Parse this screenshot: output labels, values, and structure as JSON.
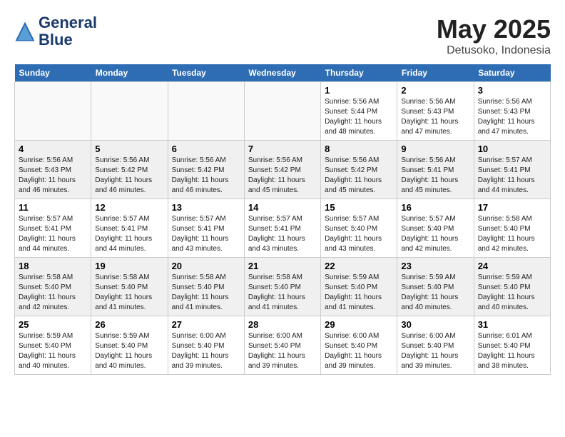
{
  "header": {
    "logo_line1": "General",
    "logo_line2": "Blue",
    "month": "May 2025",
    "location": "Detusoko, Indonesia"
  },
  "weekdays": [
    "Sunday",
    "Monday",
    "Tuesday",
    "Wednesday",
    "Thursday",
    "Friday",
    "Saturday"
  ],
  "weeks": [
    [
      {
        "day": "",
        "info": ""
      },
      {
        "day": "",
        "info": ""
      },
      {
        "day": "",
        "info": ""
      },
      {
        "day": "",
        "info": ""
      },
      {
        "day": "1",
        "info": "Sunrise: 5:56 AM\nSunset: 5:44 PM\nDaylight: 11 hours\nand 48 minutes."
      },
      {
        "day": "2",
        "info": "Sunrise: 5:56 AM\nSunset: 5:43 PM\nDaylight: 11 hours\nand 47 minutes."
      },
      {
        "day": "3",
        "info": "Sunrise: 5:56 AM\nSunset: 5:43 PM\nDaylight: 11 hours\nand 47 minutes."
      }
    ],
    [
      {
        "day": "4",
        "info": "Sunrise: 5:56 AM\nSunset: 5:43 PM\nDaylight: 11 hours\nand 46 minutes."
      },
      {
        "day": "5",
        "info": "Sunrise: 5:56 AM\nSunset: 5:42 PM\nDaylight: 11 hours\nand 46 minutes."
      },
      {
        "day": "6",
        "info": "Sunrise: 5:56 AM\nSunset: 5:42 PM\nDaylight: 11 hours\nand 46 minutes."
      },
      {
        "day": "7",
        "info": "Sunrise: 5:56 AM\nSunset: 5:42 PM\nDaylight: 11 hours\nand 45 minutes."
      },
      {
        "day": "8",
        "info": "Sunrise: 5:56 AM\nSunset: 5:42 PM\nDaylight: 11 hours\nand 45 minutes."
      },
      {
        "day": "9",
        "info": "Sunrise: 5:56 AM\nSunset: 5:41 PM\nDaylight: 11 hours\nand 45 minutes."
      },
      {
        "day": "10",
        "info": "Sunrise: 5:57 AM\nSunset: 5:41 PM\nDaylight: 11 hours\nand 44 minutes."
      }
    ],
    [
      {
        "day": "11",
        "info": "Sunrise: 5:57 AM\nSunset: 5:41 PM\nDaylight: 11 hours\nand 44 minutes."
      },
      {
        "day": "12",
        "info": "Sunrise: 5:57 AM\nSunset: 5:41 PM\nDaylight: 11 hours\nand 44 minutes."
      },
      {
        "day": "13",
        "info": "Sunrise: 5:57 AM\nSunset: 5:41 PM\nDaylight: 11 hours\nand 43 minutes."
      },
      {
        "day": "14",
        "info": "Sunrise: 5:57 AM\nSunset: 5:41 PM\nDaylight: 11 hours\nand 43 minutes."
      },
      {
        "day": "15",
        "info": "Sunrise: 5:57 AM\nSunset: 5:40 PM\nDaylight: 11 hours\nand 43 minutes."
      },
      {
        "day": "16",
        "info": "Sunrise: 5:57 AM\nSunset: 5:40 PM\nDaylight: 11 hours\nand 42 minutes."
      },
      {
        "day": "17",
        "info": "Sunrise: 5:58 AM\nSunset: 5:40 PM\nDaylight: 11 hours\nand 42 minutes."
      }
    ],
    [
      {
        "day": "18",
        "info": "Sunrise: 5:58 AM\nSunset: 5:40 PM\nDaylight: 11 hours\nand 42 minutes."
      },
      {
        "day": "19",
        "info": "Sunrise: 5:58 AM\nSunset: 5:40 PM\nDaylight: 11 hours\nand 41 minutes."
      },
      {
        "day": "20",
        "info": "Sunrise: 5:58 AM\nSunset: 5:40 PM\nDaylight: 11 hours\nand 41 minutes."
      },
      {
        "day": "21",
        "info": "Sunrise: 5:58 AM\nSunset: 5:40 PM\nDaylight: 11 hours\nand 41 minutes."
      },
      {
        "day": "22",
        "info": "Sunrise: 5:59 AM\nSunset: 5:40 PM\nDaylight: 11 hours\nand 41 minutes."
      },
      {
        "day": "23",
        "info": "Sunrise: 5:59 AM\nSunset: 5:40 PM\nDaylight: 11 hours\nand 40 minutes."
      },
      {
        "day": "24",
        "info": "Sunrise: 5:59 AM\nSunset: 5:40 PM\nDaylight: 11 hours\nand 40 minutes."
      }
    ],
    [
      {
        "day": "25",
        "info": "Sunrise: 5:59 AM\nSunset: 5:40 PM\nDaylight: 11 hours\nand 40 minutes."
      },
      {
        "day": "26",
        "info": "Sunrise: 5:59 AM\nSunset: 5:40 PM\nDaylight: 11 hours\nand 40 minutes."
      },
      {
        "day": "27",
        "info": "Sunrise: 6:00 AM\nSunset: 5:40 PM\nDaylight: 11 hours\nand 39 minutes."
      },
      {
        "day": "28",
        "info": "Sunrise: 6:00 AM\nSunset: 5:40 PM\nDaylight: 11 hours\nand 39 minutes."
      },
      {
        "day": "29",
        "info": "Sunrise: 6:00 AM\nSunset: 5:40 PM\nDaylight: 11 hours\nand 39 minutes."
      },
      {
        "day": "30",
        "info": "Sunrise: 6:00 AM\nSunset: 5:40 PM\nDaylight: 11 hours\nand 39 minutes."
      },
      {
        "day": "31",
        "info": "Sunrise: 6:01 AM\nSunset: 5:40 PM\nDaylight: 11 hours\nand 38 minutes."
      }
    ]
  ]
}
